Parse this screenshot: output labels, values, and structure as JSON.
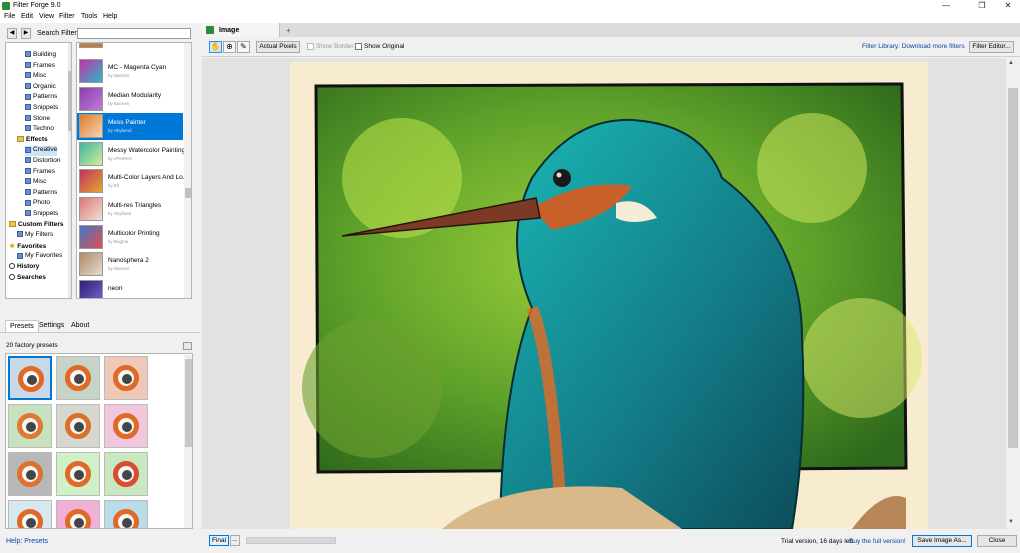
{
  "window": {
    "title": "Filter Forge 9.0",
    "minimize_glyph": "—",
    "maximize_glyph": "❐",
    "close_glyph": "✕"
  },
  "menu": [
    "File",
    "Edit",
    "View",
    "Filter",
    "Tools",
    "Help"
  ],
  "search": {
    "label": "Search Filters:",
    "value": "",
    "back_glyph": "◀",
    "forward_glyph": "▶"
  },
  "tree": {
    "items": [
      {
        "label": "Building",
        "kind": "folder",
        "indent": 2
      },
      {
        "label": "Frames",
        "kind": "folder",
        "indent": 2
      },
      {
        "label": "Misc",
        "kind": "folder",
        "indent": 2
      },
      {
        "label": "Organic",
        "kind": "folder",
        "indent": 2
      },
      {
        "label": "Patterns",
        "kind": "folder",
        "indent": 2
      },
      {
        "label": "Snippets",
        "kind": "folder",
        "indent": 2
      },
      {
        "label": "Stone",
        "kind": "folder",
        "indent": 2
      },
      {
        "label": "Techno",
        "kind": "folder",
        "indent": 2
      },
      {
        "label": "Effects",
        "kind": "group",
        "indent": 1
      },
      {
        "label": "Creative",
        "kind": "folder",
        "indent": 2,
        "selected": true
      },
      {
        "label": "Distortion",
        "kind": "folder",
        "indent": 2
      },
      {
        "label": "Frames",
        "kind": "folder",
        "indent": 2
      },
      {
        "label": "Misc",
        "kind": "folder",
        "indent": 2
      },
      {
        "label": "Patterns",
        "kind": "folder",
        "indent": 2
      },
      {
        "label": "Photo",
        "kind": "folder",
        "indent": 2
      },
      {
        "label": "Snippets",
        "kind": "folder",
        "indent": 2
      },
      {
        "label": "Custom Filters",
        "kind": "section",
        "indent": 0
      },
      {
        "label": "My Filters",
        "kind": "folder",
        "indent": 1
      },
      {
        "label": "Favorites",
        "kind": "star",
        "indent": 0
      },
      {
        "label": "My Favorites",
        "kind": "folder",
        "indent": 1
      },
      {
        "label": "History",
        "kind": "history",
        "indent": 0
      },
      {
        "label": "Searches",
        "kind": "search",
        "indent": 0
      }
    ]
  },
  "filters": [
    {
      "name": "MC - Magenta Cyan",
      "author": "by Bannier",
      "colors": [
        "#c22fa8",
        "#2fb8c8"
      ]
    },
    {
      "name": "Median Modularity",
      "author": "by Bannier",
      "colors": [
        "#8a3fb0",
        "#c27bd6"
      ]
    },
    {
      "name": "Mess Painter",
      "author": "by Skybend",
      "colors": [
        "#e07a2a",
        "#f3d6b0"
      ],
      "selected": true
    },
    {
      "name": "Messy Watercolor Painting",
      "author": "by cPeeters",
      "colors": [
        "#3fb8a0",
        "#d4ec9a"
      ]
    },
    {
      "name": "Multi-Color Layers And Lo...",
      "author": "by Ell",
      "colors": [
        "#c2325e",
        "#e0a72f"
      ]
    },
    {
      "name": "Multi-res Triangles",
      "author": "by Skybase",
      "colors": [
        "#d77878",
        "#f2e0d4"
      ]
    },
    {
      "name": "Multicolor Printing",
      "author": "by Bugme",
      "colors": [
        "#3f78c8",
        "#e05050"
      ]
    },
    {
      "name": "Nanosphera 2",
      "author": "by Bannier",
      "colors": [
        "#b08a6a",
        "#e6dccc"
      ]
    },
    {
      "name": "neon",
      "author": "",
      "colors": [
        "#2a2270",
        "#7a62d8"
      ]
    }
  ],
  "panel_tabs": [
    "Presets",
    "Settings",
    "About"
  ],
  "presets": {
    "count_label": "20 factory presets",
    "tiles": [
      {
        "bg": "#c9d9e8",
        "ring": "#e06a25",
        "selected": true
      },
      {
        "bg": "#c6d4c8",
        "ring": "#e06a25"
      },
      {
        "bg": "#f0c8b8",
        "ring": "#e06a25"
      },
      {
        "bg": "#c8e2c0",
        "ring": "#e07a30"
      },
      {
        "bg": "#d6d8d0",
        "ring": "#d8722a"
      },
      {
        "bg": "#f2c6dc",
        "ring": "#e06a25"
      },
      {
        "bg": "#b8b8b8",
        "ring": "#e07030"
      },
      {
        "bg": "#d0f0c8",
        "ring": "#e06a25"
      },
      {
        "bg": "#c8e8c0",
        "ring": "#d84e2e"
      },
      {
        "bg": "#d8e8f0",
        "ring": "#e06a25"
      },
      {
        "bg": "#f2b0d8",
        "ring": "#e06a25"
      },
      {
        "bg": "#b8dce8",
        "ring": "#e06a25"
      }
    ]
  },
  "help": "Help: Presets",
  "image_tab": {
    "label": "Image",
    "add_glyph": "+"
  },
  "toolbar": {
    "hand_glyph": "✋",
    "zoom_glyph": "⊕",
    "picker_glyph": "✎",
    "actual_pixels": "Actual Pixels",
    "show_border": "Show Border",
    "show_original": "Show Original",
    "library_link": "Filter Library: Download more filters",
    "filter_editor": "Filter Editor..."
  },
  "status": {
    "final": "Final",
    "more": "...",
    "trial": "Trial version, 16 days left.",
    "buy": "Buy the full version!",
    "save": "Save Image As...",
    "close": "Close"
  },
  "scroll_glyphs": {
    "up": "▲",
    "down": "▼"
  }
}
